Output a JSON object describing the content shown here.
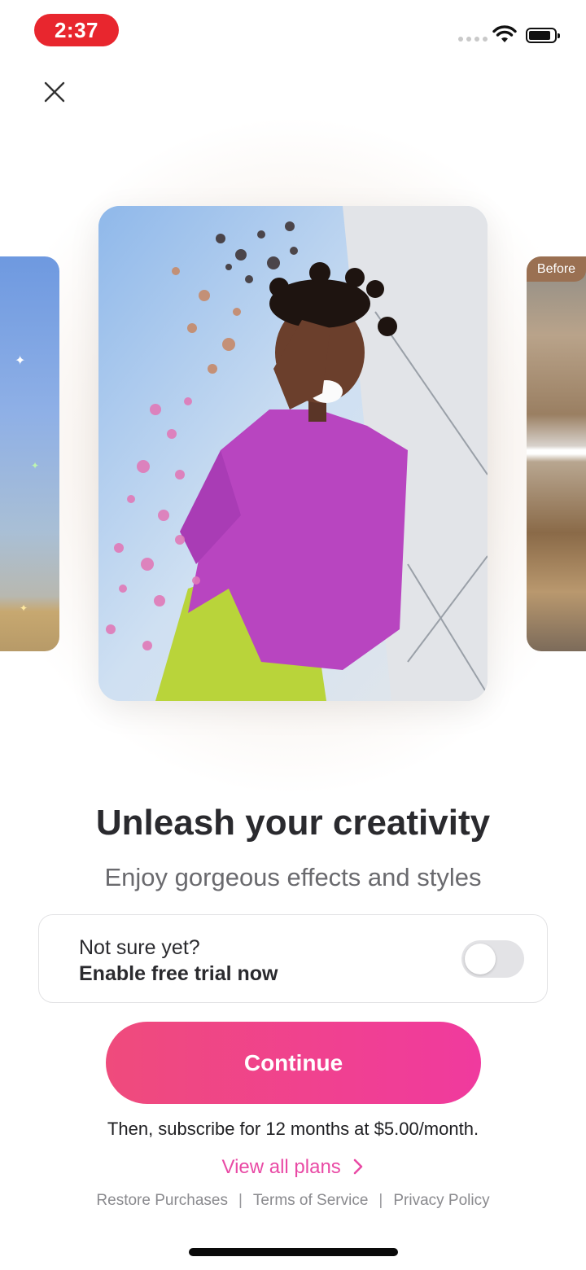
{
  "status_bar": {
    "time": "2:37"
  },
  "carousel": {
    "right_card_badge": "Before"
  },
  "content": {
    "headline": "Unleash your creativity",
    "subheadline": "Enjoy gorgeous effects and styles"
  },
  "trial": {
    "line1": "Not sure yet?",
    "line2": "Enable free trial now",
    "enabled": false
  },
  "cta": {
    "continue_label": "Continue",
    "price_text": "Then, subscribe for 12 months at $5.00/month.",
    "view_plans_label": "View all plans"
  },
  "footer": {
    "restore": "Restore Purchases",
    "terms": "Terms of Service",
    "privacy": "Privacy Policy",
    "separator": "|"
  },
  "colors": {
    "accent": "#e94aa5",
    "button_start": "#ef4b7c",
    "button_end": "#f03a9e",
    "time_pill": "#e8262e"
  },
  "icons": [
    "close-icon",
    "wifi-icon",
    "battery-icon",
    "chevron-right-icon"
  ]
}
